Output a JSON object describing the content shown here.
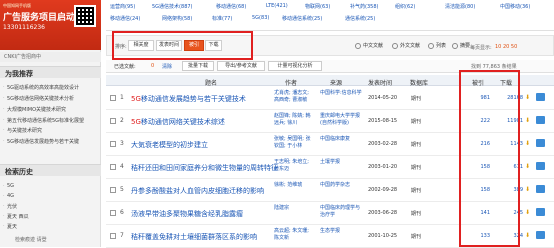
{
  "ad": {
    "line1": "中国知网手机版",
    "line2": "广告服务项目启动",
    "line3": "13301116236",
    "footer": "CNKI广告招商中"
  },
  "sidebar": {
    "section1_title": "为我推荐",
    "recommend": [
      "5G驱动系统的高效率高能效设计",
      "5G移动通信网络关键技术分析",
      "大规模MIMO关键技术研究",
      "第五代移动通信系统5G标准化展望",
      "与关键技术研究",
      "5G移动通信发展趋势与若干关键"
    ],
    "section2_title": "检索历史",
    "history": [
      "5G",
      "4G",
      "光伏",
      "夏天 西瓜",
      "夏天"
    ],
    "bottom": "检索痕迹    请登"
  },
  "tags": {
    "row1": [
      "运营商(95)",
      "5G通信技术(887)",
      "移动通信(68)",
      "LTE(421)",
      "物联网(63)",
      "补气药(358)",
      "组织(62)",
      "清洁能源(80)",
      "中国移动(36)"
    ],
    "row2": [
      "移动通信(24)",
      "网络架构(58)",
      "标准(77)",
      "5G(83)",
      "移动通信系统(25)",
      "通信系统(25)"
    ]
  },
  "sortbar": {
    "label": "排序:",
    "buttons": [
      "相关度",
      "发表时间",
      "被引",
      "下载"
    ],
    "active": "被引",
    "views": [
      "中文文献",
      "外文文献",
      "列表",
      "摘要"
    ],
    "pager_label": "每页显示:",
    "pager_values": "10 20 50"
  },
  "selbar": {
    "selected_label": "已选文献:",
    "selected_count": "0",
    "clear": "清除",
    "buttons": [
      "批量下载",
      "导出/参考文献",
      "计量可视化分析"
    ],
    "found": "找到 77,863 条结果"
  },
  "table": {
    "headers": [
      "题名",
      "作者",
      "来源",
      "发表时间",
      "数据库",
      "被引",
      "下载"
    ],
    "rows": [
      {
        "num": "1",
        "title_hl": "5G",
        "title": "移动通信发展趋势与若干关键技术",
        "authors": "尤肖虎; 潘志文; 高西奇; 曹淑敏",
        "source": "中国科学:信息科学",
        "date": "2014-05-20",
        "db": "期刊",
        "cite": "981",
        "down": "28168"
      },
      {
        "num": "2",
        "title_hl": "5G",
        "title": "移动通信网络关键技术综述",
        "authors": "赵国锋; 陈婧; 韩远兵; 徐川",
        "source": "重庆邮电大学学报(自然科学版)",
        "date": "2015-08-15",
        "db": "期刊",
        "cite": "222",
        "down": "11901"
      },
      {
        "num": "3",
        "title_hl": "",
        "title": "大気衰老模型的初步建立",
        "authors": "张敏; 吴国明; 张钦国; 于小林",
        "source": "中国临床康复",
        "date": "2003-02-28",
        "db": "期刊",
        "cite": "216",
        "down": "1143"
      },
      {
        "num": "4",
        "title_hl": "",
        "title": "秸秆还田和田间家庭养分和微生物量的周转特征",
        "authors": "王志明; 朱培立; 黄东迈",
        "source": "土壤学报",
        "date": "2003-01-20",
        "db": "期刊",
        "cite": "158",
        "down": "611"
      },
      {
        "num": "5",
        "title_hl": "",
        "title": "丹参多酚酸盐对人血管内皮细胞迁移的影响",
        "authors": "徐彬; 范维琥",
        "source": "中国药学杂志",
        "date": "2002-09-28",
        "db": "期刊",
        "cite": "158",
        "down": "389"
      },
      {
        "num": "6",
        "title_hl": "",
        "title": "汤液早带油多聚物果糖含经乳脂露瘤",
        "authors": "陆建宗",
        "source": "中国临床药理学与治疗学",
        "date": "2003-06-28",
        "db": "期刊",
        "cite": "141",
        "down": "245"
      },
      {
        "num": "7",
        "title_hl": "",
        "title": "秸秆覆盖免耕对土壤细菌群落区系的影响",
        "authors": "高云超; 朱文珊; 陈文新",
        "source": "生态学报",
        "date": "2001-10-25",
        "db": "期刊",
        "cite": "133",
        "down": "324"
      }
    ]
  }
}
